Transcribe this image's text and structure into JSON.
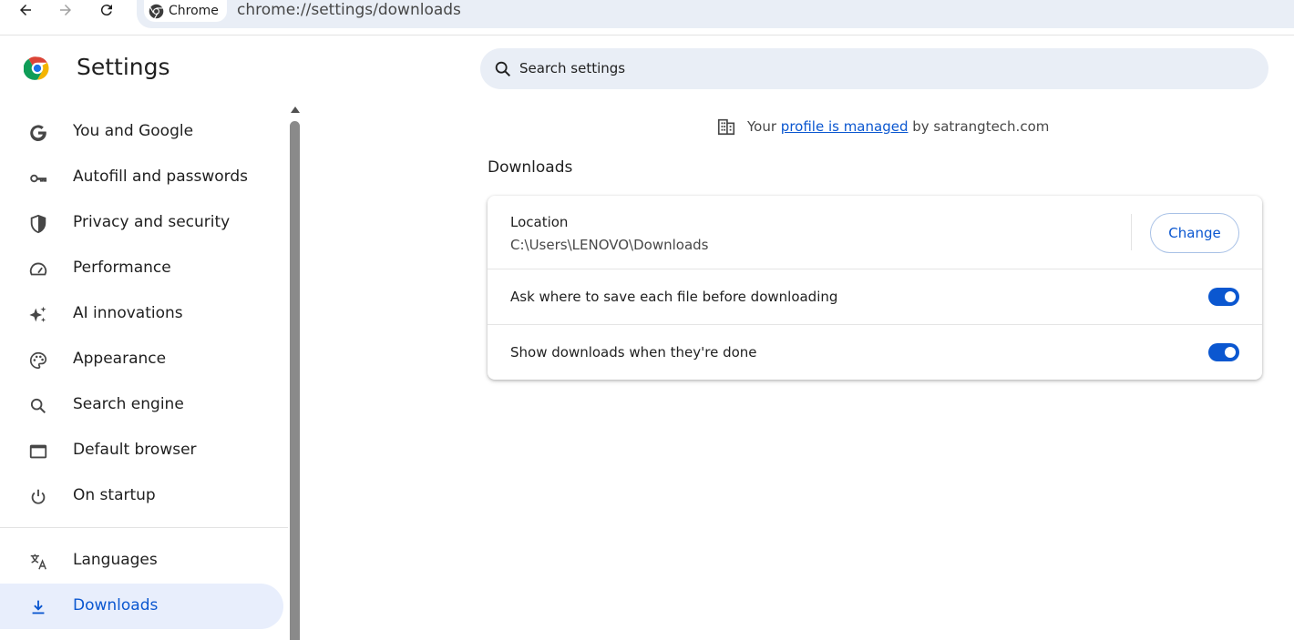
{
  "browser": {
    "chip_label": "Chrome",
    "url": "chrome://settings/downloads"
  },
  "sidebar": {
    "title": "Settings",
    "items": [
      {
        "label": "You and Google",
        "icon": "google-g-icon"
      },
      {
        "label": "Autofill and passwords",
        "icon": "key-icon"
      },
      {
        "label": "Privacy and security",
        "icon": "shield-icon"
      },
      {
        "label": "Performance",
        "icon": "speedometer-icon"
      },
      {
        "label": "AI innovations",
        "icon": "sparkle-icon"
      },
      {
        "label": "Appearance",
        "icon": "palette-icon"
      },
      {
        "label": "Search engine",
        "icon": "search-icon"
      },
      {
        "label": "Default browser",
        "icon": "browser-window-icon"
      },
      {
        "label": "On startup",
        "icon": "power-icon"
      },
      {
        "label": "Languages",
        "icon": "translate-icon"
      },
      {
        "label": "Downloads",
        "icon": "download-icon",
        "active": true
      }
    ]
  },
  "search": {
    "placeholder": "Search settings"
  },
  "managed_notice": {
    "prefix": "Your ",
    "link": "profile is managed",
    "suffix": " by satrangtech.com"
  },
  "downloads": {
    "section_title": "Downloads",
    "location_label": "Location",
    "location_path": "C:\\Users\\LENOVO\\Downloads",
    "change_label": "Change",
    "ask_where_label": "Ask where to save each file before downloading",
    "ask_where_enabled": true,
    "show_downloads_label": "Show downloads when they're done",
    "show_downloads_enabled": true
  },
  "colors": {
    "accent": "#0b57d0",
    "active_bg": "#e8eefc",
    "search_bg": "#e9eef6"
  }
}
